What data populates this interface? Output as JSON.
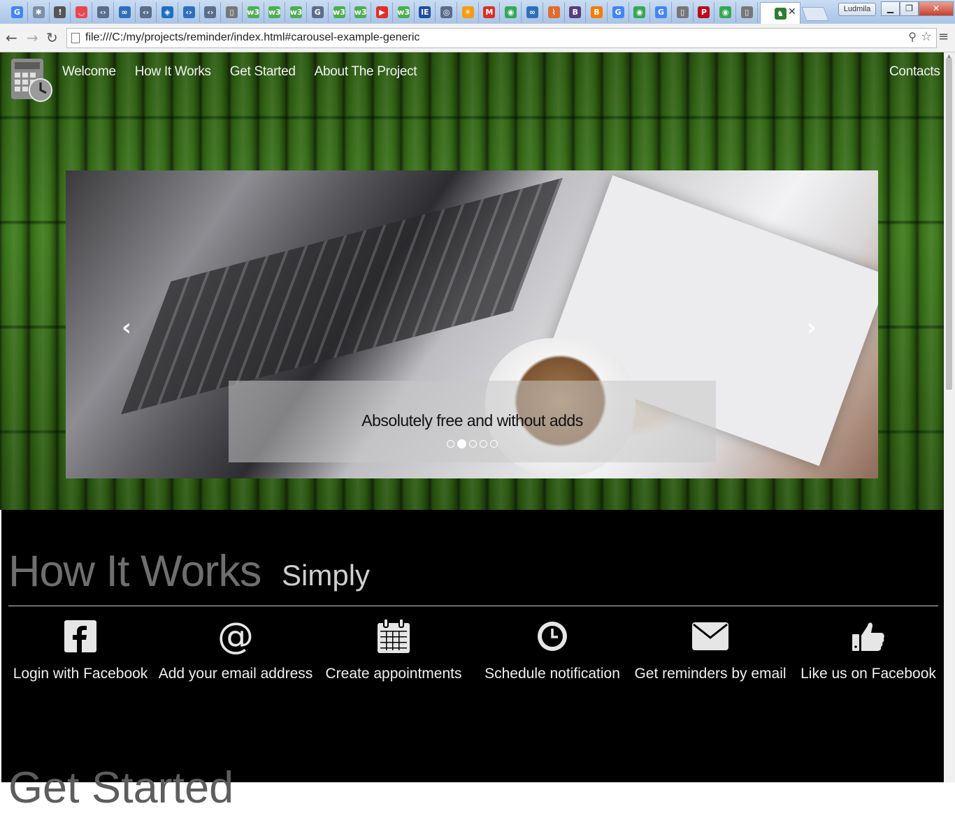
{
  "browser": {
    "profile_name": "Ludmila",
    "url": "file:///C:/my/projects/reminder/index.html#carousel-example-generic",
    "tabs": [
      {
        "icon": "google-icon",
        "letter": "G",
        "color": "#4285f4"
      },
      {
        "icon": "extension-icon",
        "letter": "✱",
        "color": "#7a8ea8"
      },
      {
        "icon": "pin-icon",
        "letter": "!",
        "color": "#555555"
      },
      {
        "icon": "pocket-icon",
        "letter": "◡",
        "color": "#e9474f"
      },
      {
        "icon": "code-icon",
        "letter": "‹›",
        "color": "#5a6d8a"
      },
      {
        "icon": "infinity-icon",
        "letter": "∞",
        "color": "#2f6fb7"
      },
      {
        "icon": "code-icon",
        "letter": "‹›",
        "color": "#5a6d8a"
      },
      {
        "icon": "bookmark-icon",
        "letter": "◈",
        "color": "#1e6fc0"
      },
      {
        "icon": "code-icon",
        "letter": "‹›",
        "color": "#2f6fb7"
      },
      {
        "icon": "code-icon",
        "letter": "‹›",
        "color": "#5a6d8a"
      },
      {
        "icon": "page-icon",
        "letter": "▯",
        "color": "#777777"
      },
      {
        "icon": "w3-icon",
        "letter": "w3",
        "color": "#4caf50"
      },
      {
        "icon": "w3-icon",
        "letter": "w3",
        "color": "#4caf50"
      },
      {
        "icon": "w3-icon",
        "letter": "w3",
        "color": "#4caf50"
      },
      {
        "icon": "g-doc-icon",
        "letter": "G",
        "color": "#5a6d8a"
      },
      {
        "icon": "w3-icon",
        "letter": "w3",
        "color": "#4caf50"
      },
      {
        "icon": "w3-icon",
        "letter": "w3",
        "color": "#4caf50"
      },
      {
        "icon": "youtube-icon",
        "letter": "▶",
        "color": "#e52d27"
      },
      {
        "icon": "w3-icon",
        "letter": "w3",
        "color": "#4caf50"
      },
      {
        "icon": "ieee-icon",
        "letter": "IE",
        "color": "#1f4e9c"
      },
      {
        "icon": "globe-icon",
        "letter": "◎",
        "color": "#5a6d8a"
      },
      {
        "icon": "asterisk-icon",
        "letter": "✳",
        "color": "#f39c12"
      },
      {
        "icon": "gmail-icon",
        "letter": "M",
        "color": "#d93025"
      },
      {
        "icon": "chrome-icon",
        "letter": "◉",
        "color": "#34a853"
      },
      {
        "icon": "infinity-icon",
        "letter": "∞",
        "color": "#2f6fb7"
      },
      {
        "icon": "leaf-icon",
        "letter": "⌇",
        "color": "#e46a2f"
      },
      {
        "icon": "bootstrap-icon",
        "letter": "B",
        "color": "#563d7c"
      },
      {
        "icon": "blogger-icon",
        "letter": "B",
        "color": "#f57d00"
      },
      {
        "icon": "google-icon",
        "letter": "G",
        "color": "#4285f4"
      },
      {
        "icon": "chrome-icon",
        "letter": "◉",
        "color": "#34a853"
      },
      {
        "icon": "google-icon",
        "letter": "G",
        "color": "#4285f4"
      },
      {
        "icon": "page-icon",
        "letter": "▯",
        "color": "#777777"
      },
      {
        "icon": "pinterest-icon",
        "letter": "P",
        "color": "#bd081c"
      },
      {
        "icon": "chrome-icon",
        "letter": "◉",
        "color": "#34a853"
      },
      {
        "icon": "page-icon",
        "letter": "▯",
        "color": "#777777"
      },
      {
        "icon": "app-icon",
        "letter": "♞",
        "color": "#2e7d32"
      }
    ]
  },
  "page": {
    "nav": {
      "items": [
        "Welcome",
        "How It Works",
        "Get Started",
        "About The Project"
      ],
      "right_item": "Contacts"
    },
    "carousel": {
      "caption": "Absolutely free and without adds",
      "indicator_count": 5,
      "active_index": 1
    },
    "how_it_works": {
      "title": "How It Works",
      "subtitle": "Simply",
      "features": [
        {
          "icon": "facebook-icon",
          "label": "Login with Facebook"
        },
        {
          "icon": "at-sign-icon",
          "label": "Add your email address"
        },
        {
          "icon": "calendar-icon",
          "label": "Create appointments"
        },
        {
          "icon": "clock-icon",
          "label": "Schedule notification"
        },
        {
          "icon": "envelope-icon",
          "label": "Get reminders by email"
        },
        {
          "icon": "thumbs-up-icon",
          "label": "Like us on Facebook"
        }
      ]
    },
    "get_started": {
      "title": "Get Started"
    }
  },
  "colors": {
    "bamboo_green": "#3e7a1c",
    "section_bg": "#000000",
    "title_gray": "#6f6f6f"
  }
}
